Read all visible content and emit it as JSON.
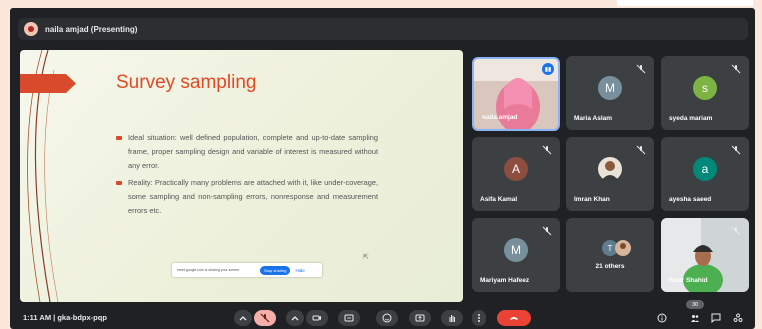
{
  "presenter": {
    "label": "naila amjad (Presenting)"
  },
  "slide": {
    "title": "Survey sampling",
    "bullets": [
      "Ideal situation: well defined population, complete and up-to-date sampling frame, proper sampling design and variable of interest is measured without any error.",
      "Reality: Practically many problems are attached with it, like under-coverage, some sampling and non-sampling errors, nonresponse and measurement errors etc."
    ],
    "sharing_bar": {
      "text": "meet.google.com is sharing your screen.",
      "stop_label": "Stop sharing",
      "hide_label": "Hide"
    }
  },
  "participants": [
    {
      "name": "naila amjad",
      "type": "video",
      "speaking": true
    },
    {
      "name": "Maria Aslam",
      "initial": "M",
      "color": "#78909c",
      "muted": true
    },
    {
      "name": "syeda mariam",
      "initial": "s",
      "color": "#7cb342",
      "muted": true
    },
    {
      "name": "Asifa Kamal",
      "initial": "A",
      "color": "#8d4e3f",
      "muted": true
    },
    {
      "name": "Imran Khan",
      "type": "photo",
      "muted": true
    },
    {
      "name": "ayesha saeed",
      "initial": "a",
      "color": "#00897b",
      "muted": true
    },
    {
      "name": "Mariyam Hafeez",
      "initial": "M",
      "color": "#78909c",
      "muted": true
    },
    {
      "name": "21 others",
      "initial": "T",
      "color": "#607d8b"
    },
    {
      "name": "Noor Shahid",
      "type": "video",
      "muted": true
    }
  ],
  "bottombar": {
    "meeting_info": "1:11 AM  |  gka-bdpx-pqp",
    "people_count": "30"
  },
  "colors": {
    "background": "#202124",
    "tile": "#3c4043",
    "accent_blue": "#1a73e8",
    "end_call_red": "#ea4335",
    "slide_accent": "#e34825"
  }
}
